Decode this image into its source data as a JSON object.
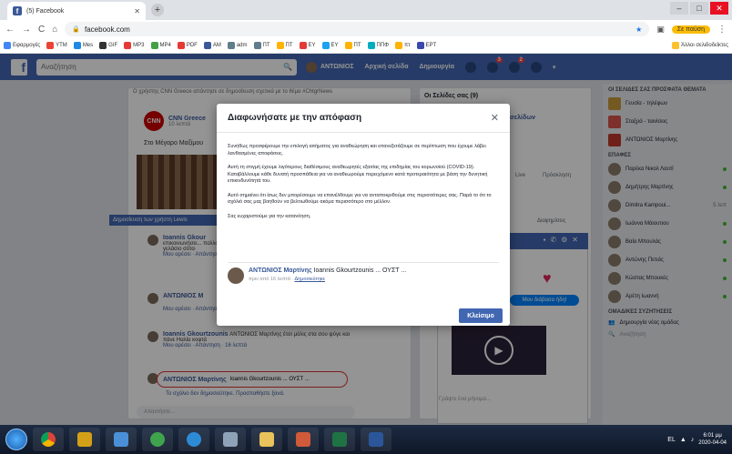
{
  "browser": {
    "tab_title": "(5) Facebook",
    "tab_close": "✕",
    "new_tab": "+",
    "url": "facebook.com",
    "paused_label": "Σε παύση",
    "bookmarks": [
      "Εφαρμογές",
      "YTM",
      "Mes",
      "GIF",
      "MP3",
      "MP4",
      "PDF",
      "AM",
      "adm",
      "ΠΤ",
      "ΠΤ",
      "EY",
      "EY",
      "ΠΤ",
      "ΠΠΦ",
      "πτ",
      "EPT"
    ],
    "other_bookmarks": "Άλλοι σελιδοδείκτες"
  },
  "facebook": {
    "search_placeholder": "Αναζήτηση",
    "user_name": "ΑΝΤΩΝΙΟΣ",
    "home_label": "Αρχική σελίδα",
    "create_label": "Δημιουργία",
    "friend_badge": "",
    "msg_badge": "3",
    "notif_badge": "2"
  },
  "background": {
    "notice": "Ο χρήστης CNN Greece απάντησε σε δημοσίευση σχετικά με το θέμα #ChtgrNews",
    "post_author": "CNN Greece",
    "post_time": "10 λεπτά",
    "post_text": "Στο Μέγαρο Μαξίμου",
    "left_bar": "Δημοσίευση των χρήστη Lewis",
    "comments": [
      {
        "name": "Ioannis Gkour",
        "text": "επικοινωνήσει... πολλούς. Ότο τα γελάσιο σότα·",
        "meta": "Μου αρέσει · Απάντηση"
      },
      {
        "name": "ΑΝΤΩΝΙΟΣ Μ",
        "text": "",
        "meta": "Μου αρέσει · Απάντηση"
      },
      {
        "name": "Ioannis Gkourtzounis",
        "text": "ΑΝΤΩΝΙΟΣ Μαρτίνης έτσι μόλις στα σου ψύγε και πάνε Ηαλία κοφτά",
        "meta": "Μου αρέσει · Απάντηση · 16 λεπτά"
      }
    ],
    "highlight_name": "ΑΝΤΩΝΙΟΣ Μαρτίνης",
    "highlight_text": "Ioannis Gkourtzounis ... ΟΥΣΤ ...",
    "highlight_meta": "Το σχόλιο δεν δημοσιεύτηκε. Προσπαθήστε ξανά.",
    "compose_placeholder": "Απαντήστε...",
    "mid_header": "Οι Σελίδες σας (9)",
    "mid_pages": "σελίδων",
    "mid_live": "Live",
    "mid_recommend": "Πρόσκληση",
    "mid_ads": "Διαφημίσεις",
    "chat_bubble": "Μου διάβασα ήδη!",
    "chat_input": "Γράψτε ένα μήνυμα..."
  },
  "right_sidebar": {
    "shortcuts_header": "ΟΙ ΣΕΛΙΔΕΣ ΣΑΣ   ΠΡΟΣΦΑΤΑ ΘΕΜΑΤΑ",
    "shortcuts": [
      "Γευσία - τηλέφων",
      "Σταξρά - ταινίσεις",
      "ΑΝΤΩΝΙΟΣ Μαρτίνης"
    ],
    "contacts_header": "ΕΠΑΦΕΣ",
    "contacts": [
      {
        "name": "Παρέκα Νικολ Λαυτί",
        "time": ""
      },
      {
        "name": "Δημήτρης Μαρτίνης",
        "time": ""
      },
      {
        "name": "Dimitra Kampoui...",
        "time": "5 λεπ"
      },
      {
        "name": "Ιωάννα Μάιουτιου",
        "time": ""
      },
      {
        "name": "Βαία Μπουλάς",
        "time": ""
      },
      {
        "name": "Αντώνης Πετιάς",
        "time": ""
      },
      {
        "name": "Κώστας Μπουκές",
        "time": ""
      },
      {
        "name": "Αρέτη Ιωαννή",
        "time": ""
      }
    ],
    "groups_header": "ΟΜΑΔΙΚΕΣ ΣΥΖΗΤΗΣΕΙΣ",
    "create_group": "Δημιουργία νέας ομάδας",
    "search_placeholder": "Αναζήτηση"
  },
  "dialog": {
    "title": "Διαφωνήσατε με την απόφαση",
    "close_icon": "✕",
    "paragraphs": [
      "Συνήθως προσφέρουμε την επιλογή αιτήματος για αναθεώρηση και επανεξετάζουμε σε περίπτωση που έχουμε λάβει λανθασμένες αποφάσεις.",
      "Αυτή τη στιγμή έχουμε λιγότερους διαθέσιμους αναθεωρητές εξαιτίας της επιδημίας του κορωνοϊού (COVID-19). Καταβάλλουμε κάθε δυνατή προσπάθεια για να αναθεωρούμε περιεχόμενο κατά προτεραιότητα με βάση την δυνητική επικινδυνότητά του.",
      "Αυτό σημαίνει ότι ίσως δεν μπορέσουμε να επανέλθουμε για να ανταποκριθούμε στις περισσότερες σας. Παρά το ότι το σχόλιό σας μας βοηθούν να βελτιωθούμε ακόμα περισσότερο στο μέλλον.",
      "Σας ευχαριστούμε για την κατανόηση."
    ],
    "comment_author": "ΑΝΤΩΝΙΟΣ Μαρτίνης",
    "comment_text": "Ioannis Gkourtzounis ... ΟΥΣΤ ...",
    "comment_time": "πριν από 16 λεπτά",
    "comment_link": "Δημοσιεύτηκε",
    "close_button": "Κλείσιμο"
  },
  "taskbar": {
    "time": "6:01 μμ",
    "date": "2020-04-04",
    "lang": "EL"
  }
}
